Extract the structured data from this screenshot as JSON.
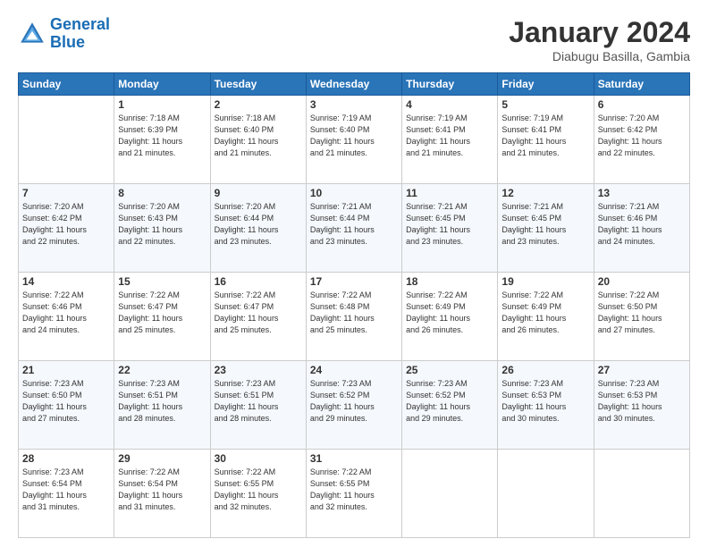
{
  "header": {
    "logo_line1": "General",
    "logo_line2": "Blue",
    "title": "January 2024",
    "subtitle": "Diabugu Basilla, Gambia"
  },
  "days_of_week": [
    "Sunday",
    "Monday",
    "Tuesday",
    "Wednesday",
    "Thursday",
    "Friday",
    "Saturday"
  ],
  "weeks": [
    [
      {
        "day": "",
        "info": ""
      },
      {
        "day": "1",
        "info": "Sunrise: 7:18 AM\nSunset: 6:39 PM\nDaylight: 11 hours\nand 21 minutes."
      },
      {
        "day": "2",
        "info": "Sunrise: 7:18 AM\nSunset: 6:40 PM\nDaylight: 11 hours\nand 21 minutes."
      },
      {
        "day": "3",
        "info": "Sunrise: 7:19 AM\nSunset: 6:40 PM\nDaylight: 11 hours\nand 21 minutes."
      },
      {
        "day": "4",
        "info": "Sunrise: 7:19 AM\nSunset: 6:41 PM\nDaylight: 11 hours\nand 21 minutes."
      },
      {
        "day": "5",
        "info": "Sunrise: 7:19 AM\nSunset: 6:41 PM\nDaylight: 11 hours\nand 21 minutes."
      },
      {
        "day": "6",
        "info": "Sunrise: 7:20 AM\nSunset: 6:42 PM\nDaylight: 11 hours\nand 22 minutes."
      }
    ],
    [
      {
        "day": "7",
        "info": "Sunrise: 7:20 AM\nSunset: 6:42 PM\nDaylight: 11 hours\nand 22 minutes."
      },
      {
        "day": "8",
        "info": "Sunrise: 7:20 AM\nSunset: 6:43 PM\nDaylight: 11 hours\nand 22 minutes."
      },
      {
        "day": "9",
        "info": "Sunrise: 7:20 AM\nSunset: 6:44 PM\nDaylight: 11 hours\nand 23 minutes."
      },
      {
        "day": "10",
        "info": "Sunrise: 7:21 AM\nSunset: 6:44 PM\nDaylight: 11 hours\nand 23 minutes."
      },
      {
        "day": "11",
        "info": "Sunrise: 7:21 AM\nSunset: 6:45 PM\nDaylight: 11 hours\nand 23 minutes."
      },
      {
        "day": "12",
        "info": "Sunrise: 7:21 AM\nSunset: 6:45 PM\nDaylight: 11 hours\nand 23 minutes."
      },
      {
        "day": "13",
        "info": "Sunrise: 7:21 AM\nSunset: 6:46 PM\nDaylight: 11 hours\nand 24 minutes."
      }
    ],
    [
      {
        "day": "14",
        "info": "Sunrise: 7:22 AM\nSunset: 6:46 PM\nDaylight: 11 hours\nand 24 minutes."
      },
      {
        "day": "15",
        "info": "Sunrise: 7:22 AM\nSunset: 6:47 PM\nDaylight: 11 hours\nand 25 minutes."
      },
      {
        "day": "16",
        "info": "Sunrise: 7:22 AM\nSunset: 6:47 PM\nDaylight: 11 hours\nand 25 minutes."
      },
      {
        "day": "17",
        "info": "Sunrise: 7:22 AM\nSunset: 6:48 PM\nDaylight: 11 hours\nand 25 minutes."
      },
      {
        "day": "18",
        "info": "Sunrise: 7:22 AM\nSunset: 6:49 PM\nDaylight: 11 hours\nand 26 minutes."
      },
      {
        "day": "19",
        "info": "Sunrise: 7:22 AM\nSunset: 6:49 PM\nDaylight: 11 hours\nand 26 minutes."
      },
      {
        "day": "20",
        "info": "Sunrise: 7:22 AM\nSunset: 6:50 PM\nDaylight: 11 hours\nand 27 minutes."
      }
    ],
    [
      {
        "day": "21",
        "info": "Sunrise: 7:23 AM\nSunset: 6:50 PM\nDaylight: 11 hours\nand 27 minutes."
      },
      {
        "day": "22",
        "info": "Sunrise: 7:23 AM\nSunset: 6:51 PM\nDaylight: 11 hours\nand 28 minutes."
      },
      {
        "day": "23",
        "info": "Sunrise: 7:23 AM\nSunset: 6:51 PM\nDaylight: 11 hours\nand 28 minutes."
      },
      {
        "day": "24",
        "info": "Sunrise: 7:23 AM\nSunset: 6:52 PM\nDaylight: 11 hours\nand 29 minutes."
      },
      {
        "day": "25",
        "info": "Sunrise: 7:23 AM\nSunset: 6:52 PM\nDaylight: 11 hours\nand 29 minutes."
      },
      {
        "day": "26",
        "info": "Sunrise: 7:23 AM\nSunset: 6:53 PM\nDaylight: 11 hours\nand 30 minutes."
      },
      {
        "day": "27",
        "info": "Sunrise: 7:23 AM\nSunset: 6:53 PM\nDaylight: 11 hours\nand 30 minutes."
      }
    ],
    [
      {
        "day": "28",
        "info": "Sunrise: 7:23 AM\nSunset: 6:54 PM\nDaylight: 11 hours\nand 31 minutes."
      },
      {
        "day": "29",
        "info": "Sunrise: 7:22 AM\nSunset: 6:54 PM\nDaylight: 11 hours\nand 31 minutes."
      },
      {
        "day": "30",
        "info": "Sunrise: 7:22 AM\nSunset: 6:55 PM\nDaylight: 11 hours\nand 32 minutes."
      },
      {
        "day": "31",
        "info": "Sunrise: 7:22 AM\nSunset: 6:55 PM\nDaylight: 11 hours\nand 32 minutes."
      },
      {
        "day": "",
        "info": ""
      },
      {
        "day": "",
        "info": ""
      },
      {
        "day": "",
        "info": ""
      }
    ]
  ]
}
